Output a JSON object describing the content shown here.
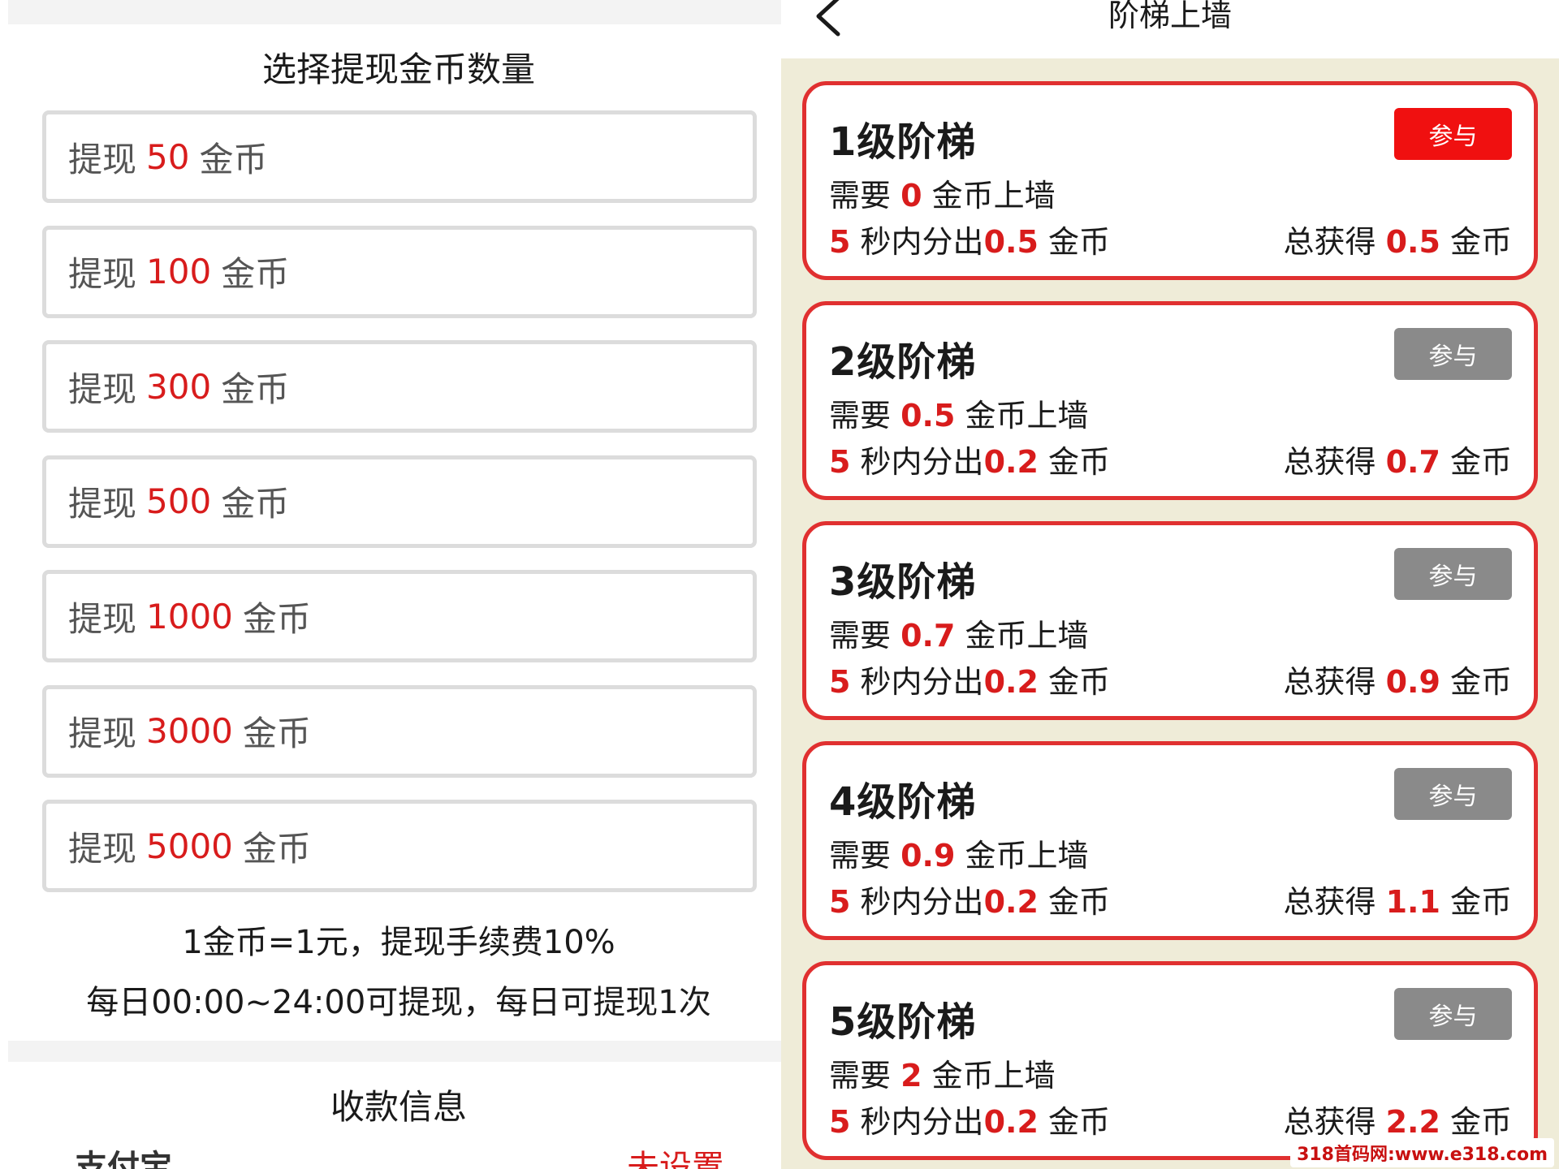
{
  "withdraw": {
    "title": "选择提现金币数量",
    "prefix": "提现",
    "suffix": "金币",
    "amounts": [
      "50",
      "100",
      "300",
      "500",
      "1000",
      "3000",
      "5000"
    ],
    "rule_rate": "1金币=1元，提现手续费10%",
    "rule_time": "每日00:00~24:00可提现，每日可提现1次",
    "payee_title": "收款信息",
    "payee_method": "支付宝",
    "payee_status": "未设置"
  },
  "ladder": {
    "title": "阶梯上墙",
    "button_label": "参与",
    "need_prefix": "需要",
    "need_suffix": "金币上墙",
    "split_middle": "秒内分出",
    "split_suffix": "金币",
    "total_prefix": "总获得",
    "total_suffix": "金币",
    "levels": [
      {
        "label": "1级阶梯",
        "need": "0",
        "seconds": "5",
        "split": "0.5",
        "total": "0.5",
        "active": true
      },
      {
        "label": "2级阶梯",
        "need": "0.5",
        "seconds": "5",
        "split": "0.2",
        "total": "0.7",
        "active": false
      },
      {
        "label": "3级阶梯",
        "need": "0.7",
        "seconds": "5",
        "split": "0.2",
        "total": "0.9",
        "active": false
      },
      {
        "label": "4级阶梯",
        "need": "0.9",
        "seconds": "5",
        "split": "0.2",
        "total": "1.1",
        "active": false
      },
      {
        "label": "5级阶梯",
        "need": "2",
        "seconds": "5",
        "split": "0.2",
        "total": "2.2",
        "active": false
      }
    ]
  },
  "watermark": "318首码网:www.e318.com",
  "colors": {
    "accent_red": "#d81c1c",
    "active_button": "#f01010",
    "inactive_button": "#8a8a8a",
    "card_border": "#e03030",
    "ladder_background": "#efecd8"
  }
}
